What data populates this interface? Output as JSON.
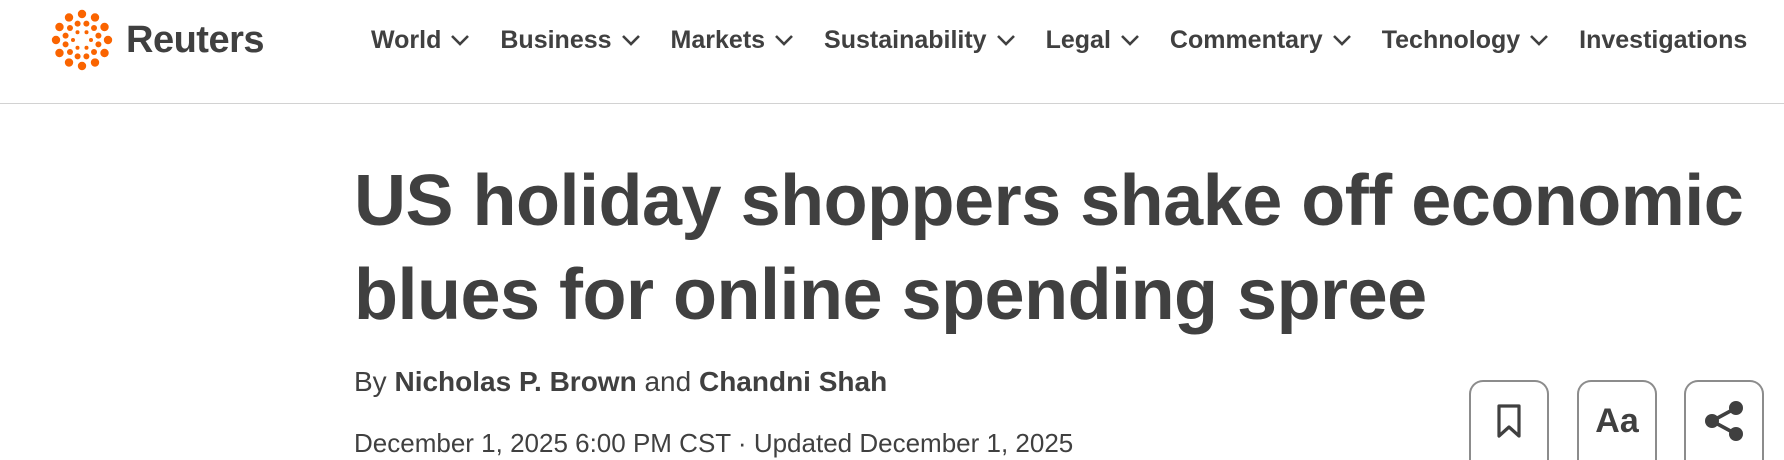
{
  "brand": {
    "name": "Reuters",
    "logo_icon": "reuters-dots-logo-icon",
    "accent_color": "#fa6400"
  },
  "nav": {
    "items": [
      {
        "label": "World",
        "has_dropdown": true
      },
      {
        "label": "Business",
        "has_dropdown": true
      },
      {
        "label": "Markets",
        "has_dropdown": true
      },
      {
        "label": "Sustainability",
        "has_dropdown": true
      },
      {
        "label": "Legal",
        "has_dropdown": true
      },
      {
        "label": "Commentary",
        "has_dropdown": true
      },
      {
        "label": "Technology",
        "has_dropdown": true
      },
      {
        "label": "Investigations",
        "has_dropdown": false
      }
    ]
  },
  "article": {
    "headline": "US holiday shoppers shake off economic blues for online spending spree",
    "byline": {
      "prefix": "By",
      "author1": "Nicholas P. Brown",
      "conjunction": "and",
      "author2": "Chandni Shah"
    },
    "dateline": "December 1, 2025 6:00 PM CST · Updated December 1, 2025"
  },
  "toolbar": {
    "bookmark_icon": "bookmark-icon",
    "font_label": "Aa",
    "share_icon": "share-icon"
  }
}
